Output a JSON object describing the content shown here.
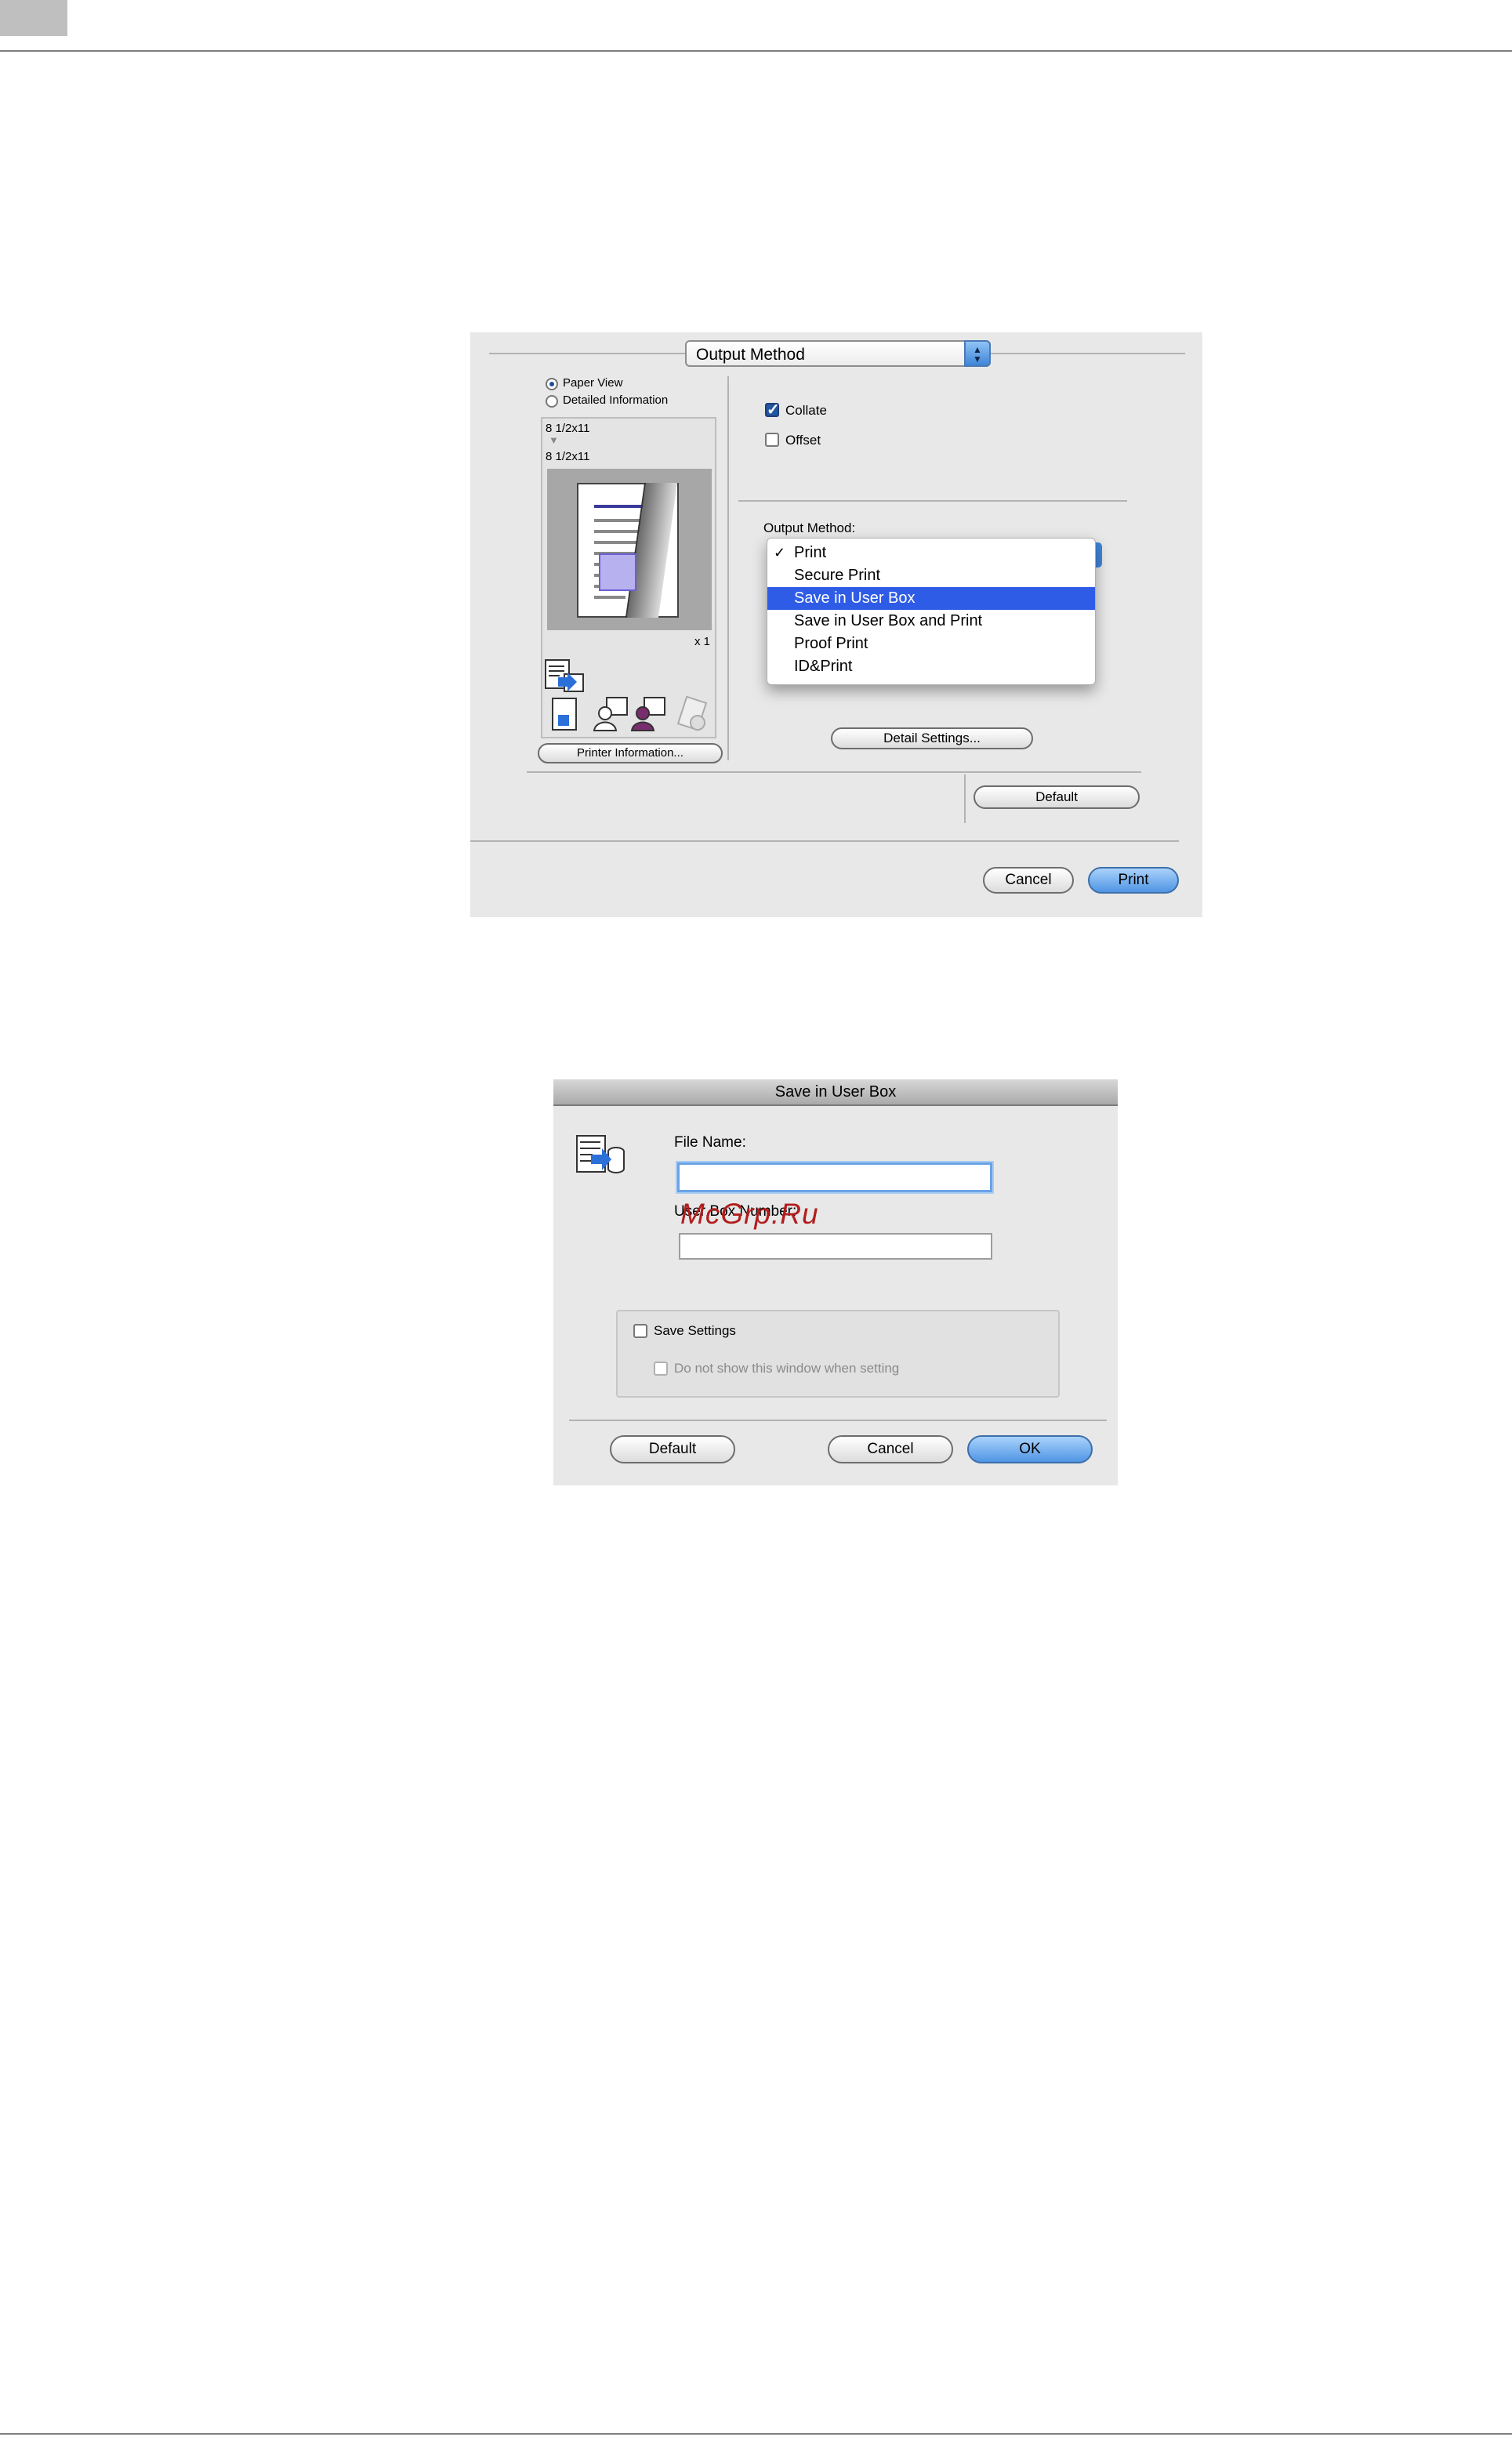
{
  "print_dialog": {
    "popup_title": "Output Method",
    "view_options": [
      {
        "label": "Paper View",
        "selected": true
      },
      {
        "label": "Detailed Information",
        "selected": false
      }
    ],
    "preview": {
      "original_size": "8 1/2x11",
      "output_size": "8 1/2x11",
      "copies": "x 1"
    },
    "printer_info_button": "Printer Information...",
    "collate_label": "Collate",
    "collate_checked": true,
    "offset_label": "Offset",
    "offset_checked": false,
    "output_method_label": "Output Method:",
    "output_menu": {
      "items": [
        "Print",
        "Secure Print",
        "Save in User Box",
        "Save in User Box and Print",
        "Proof Print",
        "ID&Print"
      ],
      "checked": "Print",
      "highlighted": "Save in User Box"
    },
    "detail_settings_button": "Detail Settings...",
    "default_button": "Default",
    "cancel_button": "Cancel",
    "print_button": "Print"
  },
  "save_dialog": {
    "title": "Save in User Box",
    "file_name_label": "File Name:",
    "file_name_value": "",
    "user_box_label": "User Box Number:",
    "user_box_value": "",
    "save_settings_label": "Save Settings",
    "save_settings_checked": false,
    "dont_show_label": "Do not show this window when setting",
    "dont_show_checked": false,
    "default_button": "Default",
    "cancel_button": "Cancel",
    "ok_button": "OK"
  },
  "watermark": "McGrp.Ru",
  "colors": {
    "dialog_bg": "#e8e8e8",
    "accent_blue": "#2f5ce6",
    "default_button_blue": "#4f95e4",
    "watermark_red": "#b21d1d"
  }
}
